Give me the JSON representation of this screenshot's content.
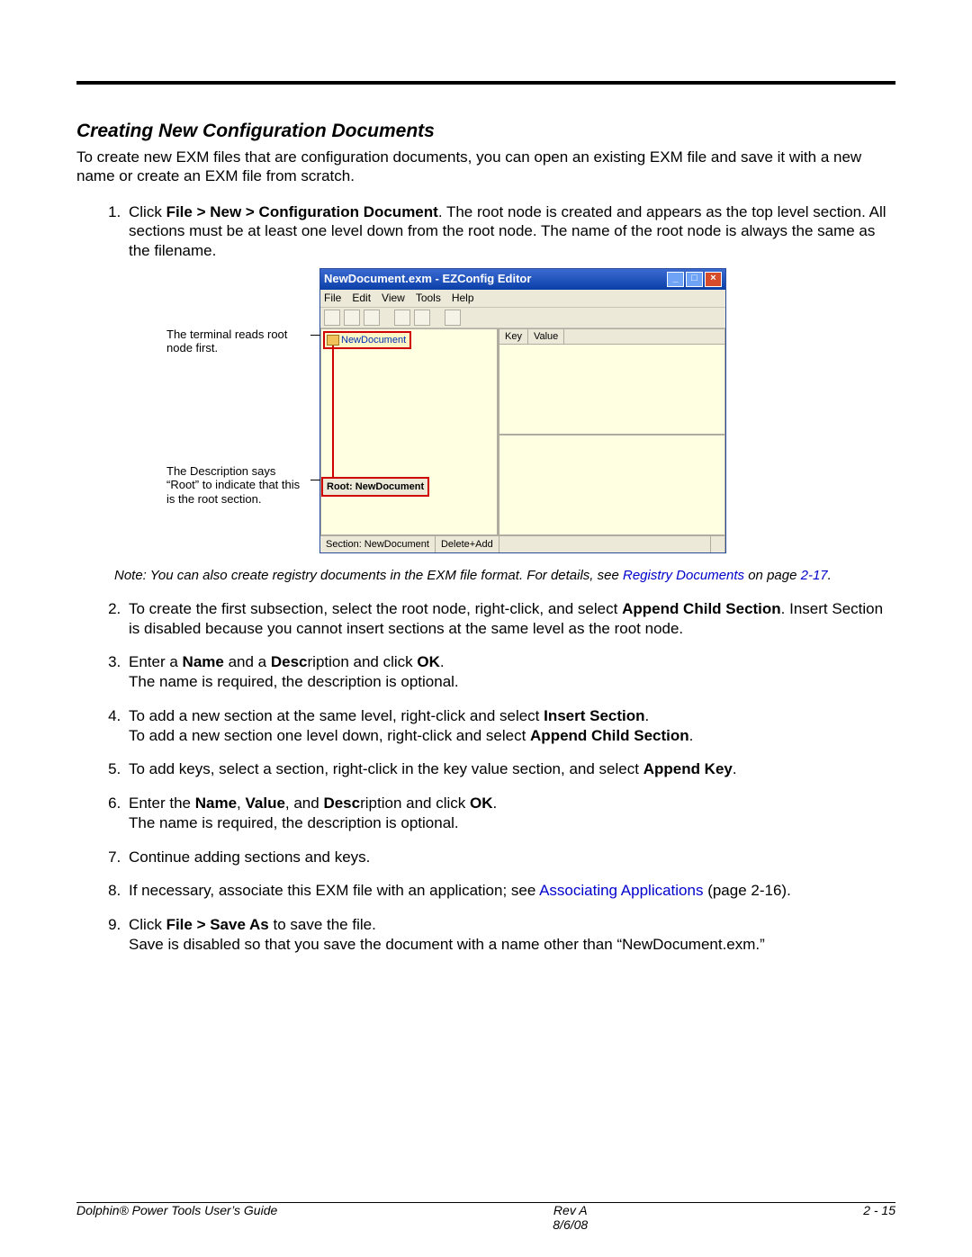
{
  "heading": "Creating New Configuration Documents",
  "intro": "To create new EXM files that are configuration documents, you can open an existing EXM file and save it with a new name or create an EXM file from scratch.",
  "step1": {
    "prefix": "Click ",
    "path": "File > New > Configuration Document",
    "rest": ". The root node is created and appears as the top level section. All sections must be at least one level down from the root node. The name of the root node is always the same as the filename."
  },
  "callout1": "The terminal reads root node first.",
  "callout2": "The Description says “Root” to indicate that this is the root section.",
  "app": {
    "title_doc": "NewDocument.exm",
    "title_app": "- EZConfig Editor",
    "menus": [
      "File",
      "Edit",
      "View",
      "Tools",
      "Help"
    ],
    "root_label": "NewDocument",
    "root_desc": "Root: NewDocument",
    "kv_key": "Key",
    "kv_val": "Value",
    "status_section": "Section: NewDocument",
    "status_mode": "Delete+Add"
  },
  "note": {
    "lead": "Note: You can also create registry documents in the EXM file format. For details, see ",
    "link": "Registry Documents",
    "mid": " on page ",
    "page": "2-17",
    "tail": "."
  },
  "step2": {
    "a": "To create the first subsection, select the root node, right-click, and select ",
    "b": "Append Child Section",
    "c": ". Insert Section is disabled because you cannot insert sections at the same level as the root node."
  },
  "step3": {
    "a": "Enter a ",
    "name": "Name",
    "b": " and a ",
    "desc": "Desc",
    "c": "ription and click ",
    "ok": "OK",
    "d": ".",
    "line2": "The name is required, the description is optional."
  },
  "step4": {
    "a": "To add a new section at the same level, right-click and select ",
    "ins": "Insert Section",
    "b": ".",
    "c": "To add a new section one level down, right-click and select ",
    "app": "Append Child Section",
    "d": "."
  },
  "step5": {
    "a": "To add keys, select a section, right-click in the key value section, and select ",
    "ak": "Append Key",
    "b": "."
  },
  "step6": {
    "a": "Enter the ",
    "name": "Name",
    "b": ", ",
    "val": "Value",
    "c": ", and ",
    "desc": "Desc",
    "d": "ription and click ",
    "ok": "OK",
    "e": ".",
    "line2": "The name is required, the description is optional."
  },
  "step7": "Continue adding sections and keys.",
  "step8": {
    "a": "If necessary, associate this EXM file with an application; see ",
    "link": "Associating Applications",
    "b": " (page 2-16)."
  },
  "step9": {
    "a": "Click ",
    "path": "File > Save As",
    "b": " to save the file.",
    "line2": "Save is disabled so that you save the document with a name other than “NewDocument.exm.”"
  },
  "footer": {
    "left": "Dolphin® Power Tools User’s Guide",
    "center1": "Rev A",
    "center2": "8/6/08",
    "right": "2 - 15"
  }
}
